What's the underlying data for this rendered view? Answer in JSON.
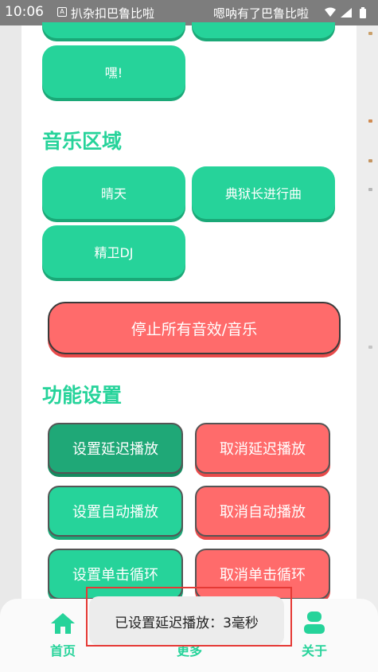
{
  "status_bar": {
    "time": "10:06",
    "app_badge": "A",
    "notification_1": "扒杂扣巴鲁比啦",
    "notification_2": "嗯呐有了巴鲁比啦"
  },
  "top_buttons": {
    "hey_label": "嘿!"
  },
  "music_section": {
    "title": "音乐区域",
    "buttons": [
      "晴天",
      "典狱长进行曲",
      "精卫DJ"
    ],
    "stop_all_label": "停止所有音效/音乐"
  },
  "settings_section": {
    "title": "功能设置",
    "buttons": {
      "set_delay": "设置延迟播放",
      "cancel_delay": "取消延迟播放",
      "set_auto": "设置自动播放",
      "cancel_auto": "取消自动播放",
      "set_loop": "设置单击循环",
      "cancel_loop": "取消单击循环"
    }
  },
  "toast": {
    "message": "已设置延迟播放：3毫秒"
  },
  "bottom_nav": {
    "items": [
      {
        "label": "首页",
        "icon": "home-icon"
      },
      {
        "label": "更多",
        "icon": "more-icon"
      },
      {
        "label": "关于",
        "icon": "person-icon"
      }
    ]
  },
  "colors": {
    "accent_green": "#26d39a",
    "accent_green_dark": "#1fa877",
    "accent_red": "#ff6b6b",
    "highlight_red": "#e53935"
  }
}
